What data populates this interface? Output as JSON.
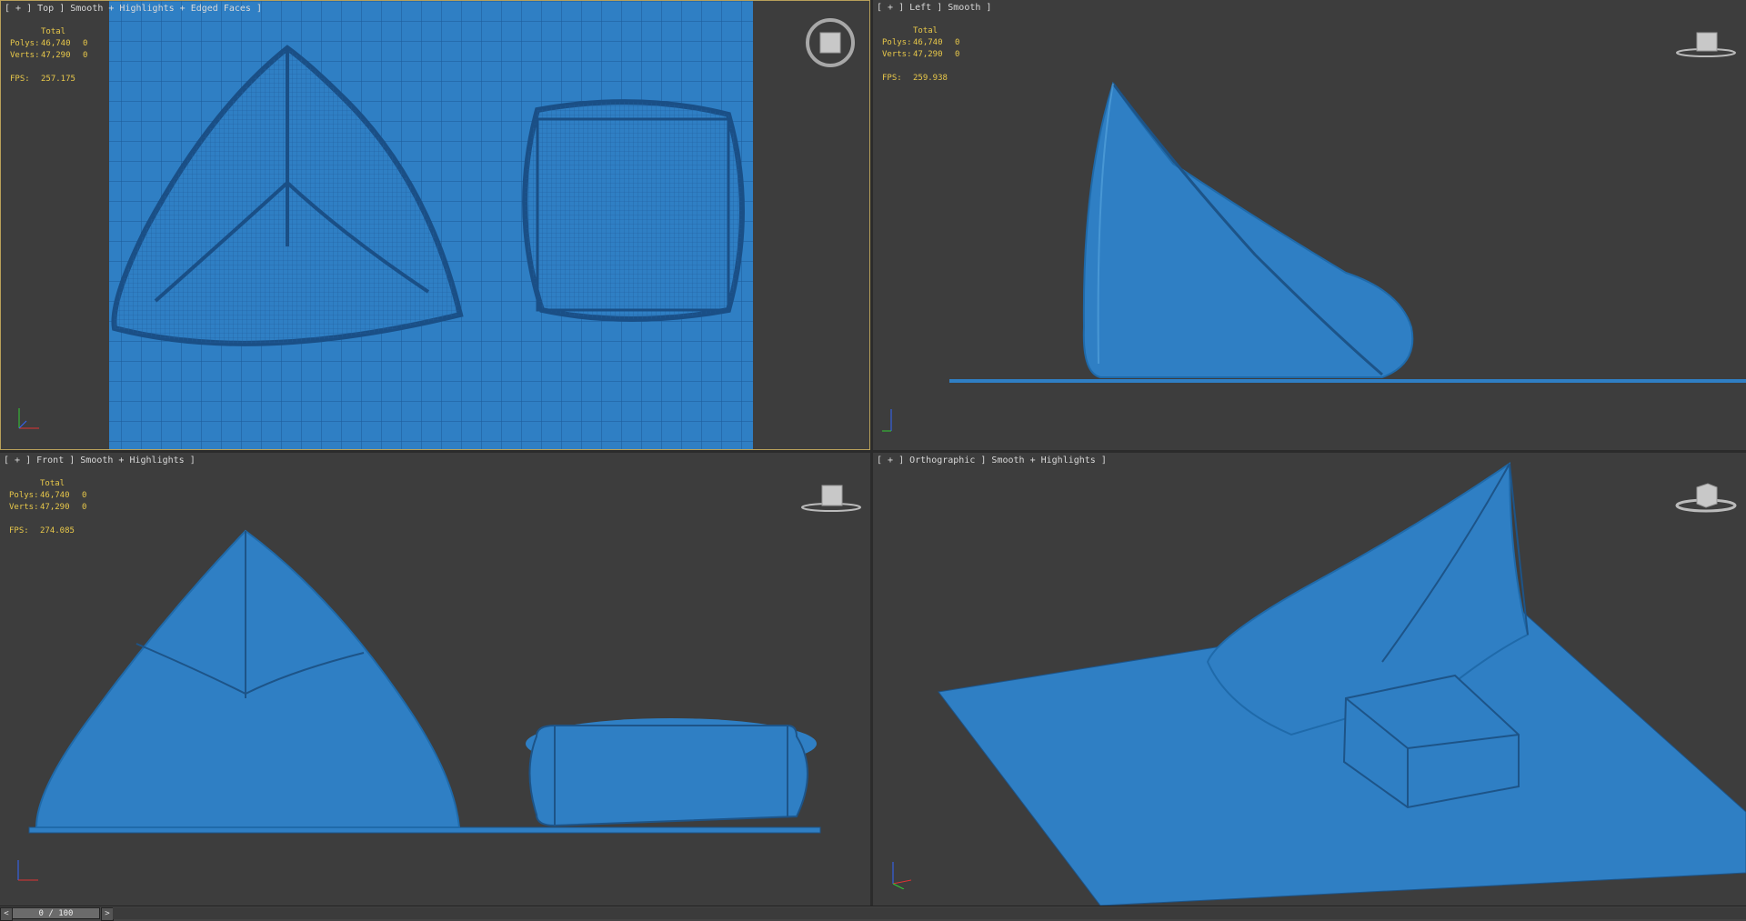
{
  "viewports": {
    "top": {
      "label": "[ + ] Top ] Smooth + Highlights + Edged Faces ]"
    },
    "left": {
      "label": "[ + ] Left ] Smooth ]"
    },
    "front": {
      "label": "[ + ] Front ] Smooth + Highlights ]"
    },
    "ortho": {
      "label": "[ + ] Orthographic ] Smooth + Highlights ]"
    }
  },
  "stats": {
    "total_label": "Total",
    "polys_label": "Polys:",
    "polys_value": "46,740",
    "polys_sel": "0",
    "verts_label": "Verts:",
    "verts_value": "47,290",
    "verts_sel": "0",
    "fps_label": "FPS:",
    "fps_top": "257.175",
    "fps_left": "259.938",
    "fps_front": "274.085"
  },
  "viewcube": {
    "top": "TOP",
    "left": "LEFT",
    "front": "FRONT",
    "ortho": "RIGHT"
  },
  "axis": {
    "x": "x",
    "y": "y",
    "z": "z"
  },
  "timeline": {
    "frame": "0 / 100",
    "prev": "<",
    "next": ">"
  },
  "colors": {
    "mesh": "#2f7fc4",
    "mesh_dark": "#1f5a94",
    "viewport_bg": "#3d3d3d",
    "active_border": "#b8a05a",
    "stats_text": "#e8c84a"
  }
}
